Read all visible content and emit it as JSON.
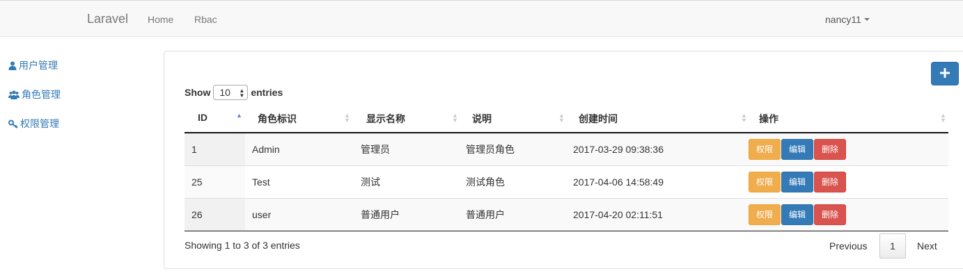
{
  "navbar": {
    "brand": "Laravel",
    "links": [
      "Home",
      "Rbac"
    ],
    "user": "nancy11"
  },
  "sidebar": {
    "items": [
      {
        "label": "用户管理",
        "icon": "user-icon"
      },
      {
        "label": "角色管理",
        "icon": "users-icon"
      },
      {
        "label": "权限管理",
        "icon": "key-icon"
      }
    ]
  },
  "toolbar": {
    "add_icon": "plus-icon"
  },
  "length_control": {
    "prefix": "Show",
    "value": "10",
    "suffix": "entries"
  },
  "table": {
    "columns": [
      "ID",
      "角色标识",
      "显示名称",
      "说明",
      "创建时间",
      "操作"
    ],
    "rows": [
      {
        "id": "1",
        "name": "Admin",
        "display": "管理员",
        "desc": "管理员角色",
        "created": "2017-03-29 09:38:36"
      },
      {
        "id": "25",
        "name": "Test",
        "display": "测试",
        "desc": "测试角色",
        "created": "2017-04-06 14:58:49"
      },
      {
        "id": "26",
        "name": "user",
        "display": "普通用户",
        "desc": "普通用户",
        "created": "2017-04-20 02:11:51"
      }
    ],
    "actions": {
      "permission": "权限",
      "edit": "编辑",
      "delete": "删除"
    }
  },
  "footer": {
    "info": "Showing 1 to 3 of 3 entries",
    "previous": "Previous",
    "page": "1",
    "next": "Next"
  },
  "colors": {
    "primary": "#337ab7",
    "warning": "#f0ad4e",
    "danger": "#d9534f"
  }
}
